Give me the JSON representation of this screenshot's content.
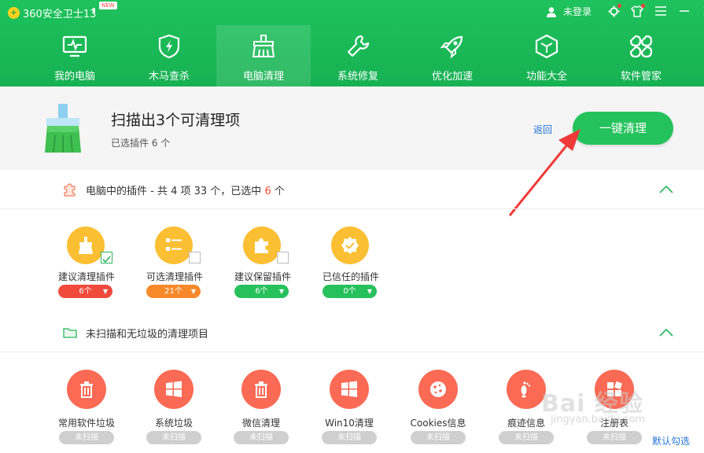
{
  "app": {
    "title": "360安全卫士13",
    "new_badge": "NEW"
  },
  "topbar": {
    "user_label": "未登录"
  },
  "nav": [
    {
      "label": "我的电脑"
    },
    {
      "label": "木马查杀"
    },
    {
      "label": "电脑清理",
      "active": true
    },
    {
      "label": "系统修复"
    },
    {
      "label": "优化加速"
    },
    {
      "label": "功能大全"
    },
    {
      "label": "软件管家"
    }
  ],
  "summary": {
    "title": "扫描出3个可清理项",
    "subtitle": "已选插件 6 个",
    "back_label": "返回",
    "clean_label": "一键清理"
  },
  "plugins_section": {
    "title_prefix": "电脑中的插件 - 共 4 项 33 个，已选中",
    "selected_count": "6",
    "title_suffix": "个",
    "items": [
      {
        "label": "建议清理插件",
        "count": "6个",
        "checked": true,
        "color": "#f04a3c"
      },
      {
        "label": "可选清理插件",
        "count": "21个",
        "checked": false,
        "color": "#f7892a"
      },
      {
        "label": "建议保留插件",
        "count": "6个",
        "checked": false,
        "color": "#27c15b"
      },
      {
        "label": "已信任的插件",
        "count": "0个",
        "checked": false,
        "color": "#27c15b"
      }
    ]
  },
  "unscanned_section": {
    "title": "未扫描和无垃圾的清理项目",
    "items": [
      {
        "label": "常用软件垃圾",
        "status": "未扫描",
        "icon": "trash-icon"
      },
      {
        "label": "系统垃圾",
        "status": "未扫描",
        "icon": "windows-icon"
      },
      {
        "label": "微信清理",
        "status": "未扫描",
        "icon": "trash-icon"
      },
      {
        "label": "Win10清理",
        "status": "未扫描",
        "icon": "windows-icon"
      },
      {
        "label": "Cookies信息",
        "status": "未扫描",
        "icon": "cookie-icon"
      },
      {
        "label": "痕迹信息",
        "status": "未扫描",
        "icon": "footprint-icon"
      },
      {
        "label": "注册表",
        "status": "未扫描",
        "icon": "registry-icon"
      }
    ],
    "default_select_label": "默认勾选"
  },
  "watermark": {
    "text": "Bai 经验",
    "sub": "jingyan.baidu.com"
  },
  "colors": {
    "brand_green": "#1ec25c",
    "button_green": "#24c25c",
    "accent_red": "#f04a2a",
    "link_blue": "#2272d8"
  }
}
